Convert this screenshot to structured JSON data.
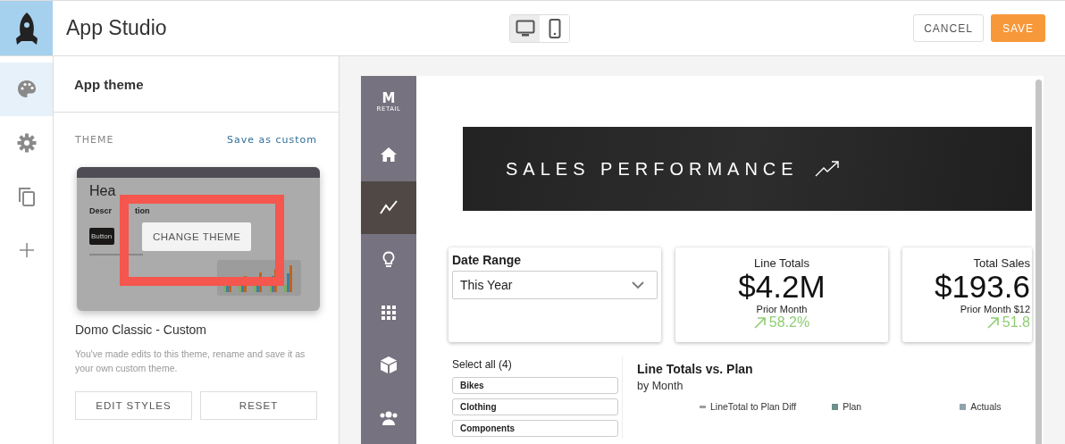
{
  "app": {
    "title": "App Studio"
  },
  "rail": [
    {
      "kind": "palette",
      "selected": true
    },
    {
      "kind": "gear",
      "selected": false
    },
    {
      "kind": "copy",
      "selected": false
    },
    {
      "kind": "plus",
      "selected": false
    }
  ],
  "view_toggle": [
    {
      "kind": "desktop",
      "selected": true
    },
    {
      "kind": "mobile",
      "selected": false
    }
  ],
  "actions": {
    "cancel": "CANCEL",
    "save": "SAVE"
  },
  "panel": {
    "title": "App theme",
    "section": "THEME",
    "link": "Save as custom",
    "preview": {
      "heading": "Hea",
      "description": [
        "Descr",
        "tion"
      ],
      "buttons": [
        "Button"
      ],
      "overlay_button": "CHANGE THEME"
    },
    "theme_name": "Domo Classic - Custom",
    "note": "You've made edits to this theme, rename and save it as your own custom theme.",
    "buttons": [
      "EDIT STYLES",
      "RESET"
    ]
  },
  "preview": {
    "brand": "M",
    "brand_sub": "RETAIL",
    "nav": [
      {
        "kind": "home",
        "selected": false
      },
      {
        "kind": "trend",
        "selected": true
      },
      {
        "kind": "bulb",
        "selected": false
      },
      {
        "kind": "grid",
        "selected": false
      },
      {
        "kind": "cube",
        "selected": false
      },
      {
        "kind": "people",
        "selected": false
      }
    ],
    "banner": "SALES PERFORMANCE",
    "date_range": {
      "label": "Date Range",
      "value": "This Year"
    },
    "kpis": [
      {
        "title": "Line Totals",
        "value": "$4.2M",
        "caption": "Prior Month",
        "change": "58.2%"
      },
      {
        "title": "Total Sales",
        "value": "$193.6",
        "caption": "Prior Month $12",
        "change": "51.8"
      }
    ],
    "filter": {
      "select_all": "Select all (4)",
      "options": [
        "Bikes",
        "Clothing",
        "Components"
      ]
    },
    "chart": {
      "title": "Line Totals vs. Plan",
      "subtitle": "by Month",
      "legend": [
        {
          "name": "LineTotal to Plan Diff",
          "kind": "line",
          "color": "#9e9e9e"
        },
        {
          "name": "Plan",
          "kind": "square",
          "color": "#6f8f8a"
        },
        {
          "name": "Actuals",
          "kind": "square",
          "color": "#8fa3ab"
        }
      ]
    }
  }
}
